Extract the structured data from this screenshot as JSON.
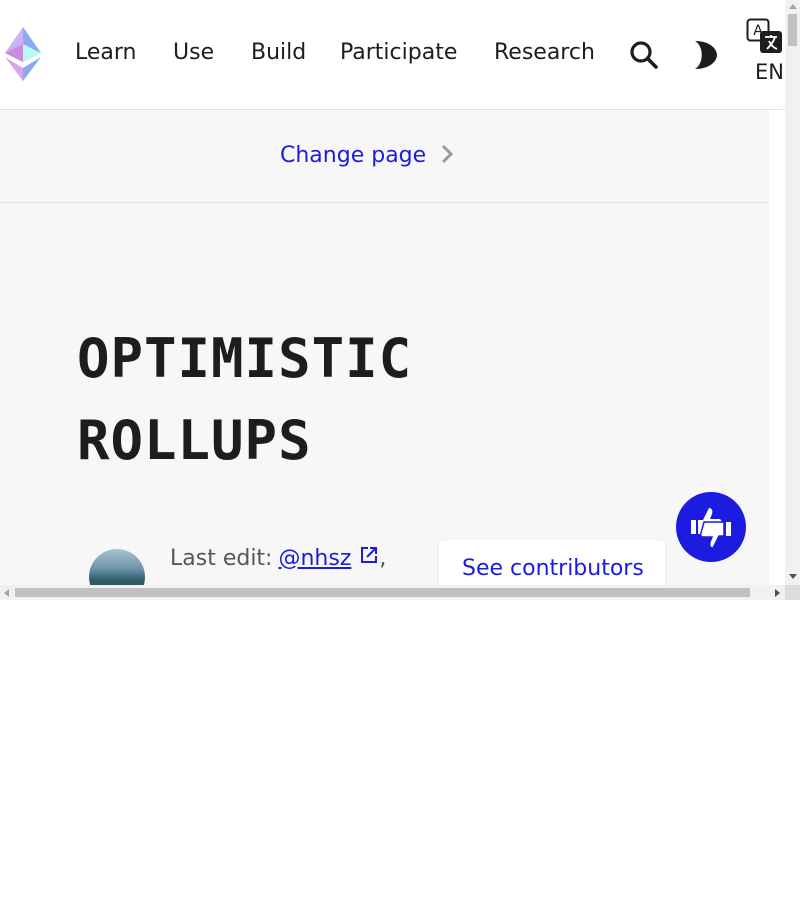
{
  "header": {
    "nav": [
      "Learn",
      "Use",
      "Build",
      "Participate",
      "Research"
    ],
    "language_code": "EN",
    "icons": {
      "logo": "ethereum-logo-icon",
      "search": "search-icon",
      "theme": "dark-mode-icon",
      "language": "translate-icon"
    }
  },
  "change_page": {
    "label": "Change page",
    "icon": "chevron-right-icon"
  },
  "article": {
    "title_line1": "OPTIMISTIC",
    "title_line2": "ROLLUPS"
  },
  "last_edit": {
    "prefix": "Last edit:",
    "user": "@nhsz",
    "suffix": ","
  },
  "contributors_button": "See contributors",
  "feedback": {
    "icon": "thumbs-up-down-icon"
  },
  "colors": {
    "accent": "#1c1ce1",
    "text": "#1d1d1d",
    "background": "#f7f7f7"
  }
}
